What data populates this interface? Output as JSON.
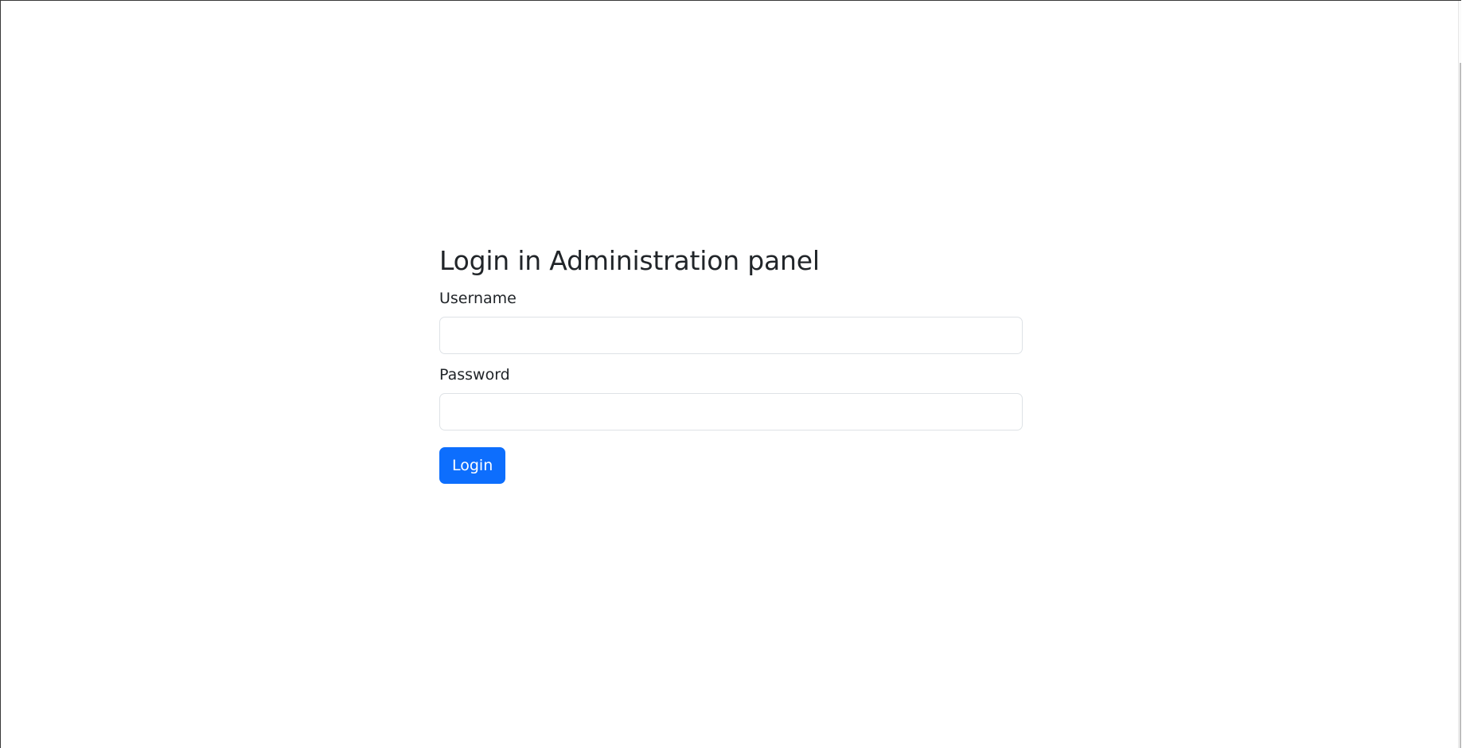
{
  "login": {
    "title": "Login in Administration panel",
    "username": {
      "label": "Username",
      "value": "",
      "placeholder": ""
    },
    "password": {
      "label": "Password",
      "value": "",
      "placeholder": ""
    },
    "submit_label": "Login"
  },
  "colors": {
    "primary": "#0d6efd",
    "text": "#212529",
    "input_border": "#dee2e6",
    "background": "#ffffff"
  }
}
